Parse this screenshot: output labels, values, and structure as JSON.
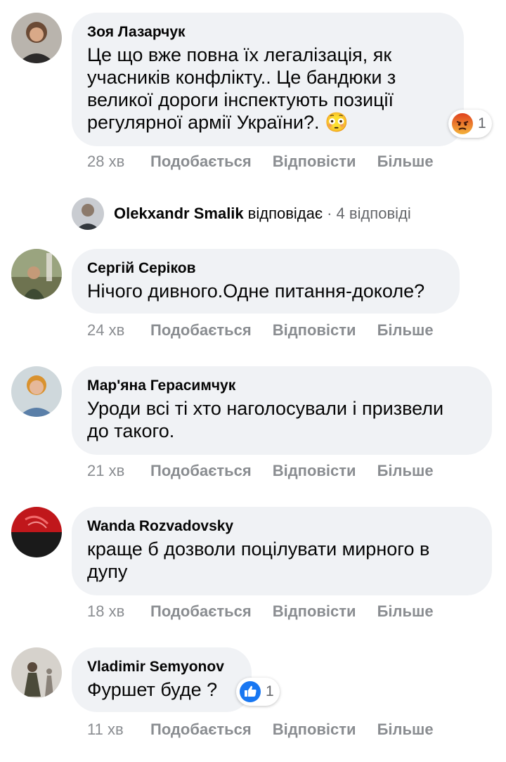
{
  "actions": {
    "like": "Подобається",
    "reply": "Відповісти",
    "more": "Більше"
  },
  "comments": [
    {
      "author": "Зоя Лазарчук",
      "lines": [
        "Це що вже повна їх легалізація, як",
        "учасників конфлікту.. Це бандюки з",
        "великої дороги інспектують позиції",
        "регулярної армії України?. 😳"
      ],
      "time": "28 хв",
      "reaction_icon": "angry-icon",
      "reaction_count": "1"
    },
    {
      "author": "Сергій Серіков",
      "lines": [
        "Нічого дивного.Одне питання-доколе?"
      ],
      "time": "24 хв"
    },
    {
      "author": "Мар'яна Герасимчук",
      "lines": [
        "Уроди всі ті хто наголосували і призвели",
        "до такого."
      ],
      "time": "21 хв"
    },
    {
      "author": "Wanda Rozvadovsky",
      "lines": [
        "краще б дозволи поцілувати мирного в",
        "дупу"
      ],
      "time": "18 хв"
    },
    {
      "author": "Vladimir Semyonov",
      "lines": [
        "Фуршет буде ?"
      ],
      "time": "11 хв",
      "reaction_icon": "like-icon",
      "reaction_count": "1"
    }
  ],
  "reply_summary": {
    "author": "Olekxandr Smalik",
    "verb": "відповідає",
    "count": "· 4 відповіді"
  },
  "colors": {
    "bubble": "#f0f2f5",
    "muted": "#8a8d91",
    "like_blue": "#1877f2",
    "angry_orange": "#e9710f"
  }
}
